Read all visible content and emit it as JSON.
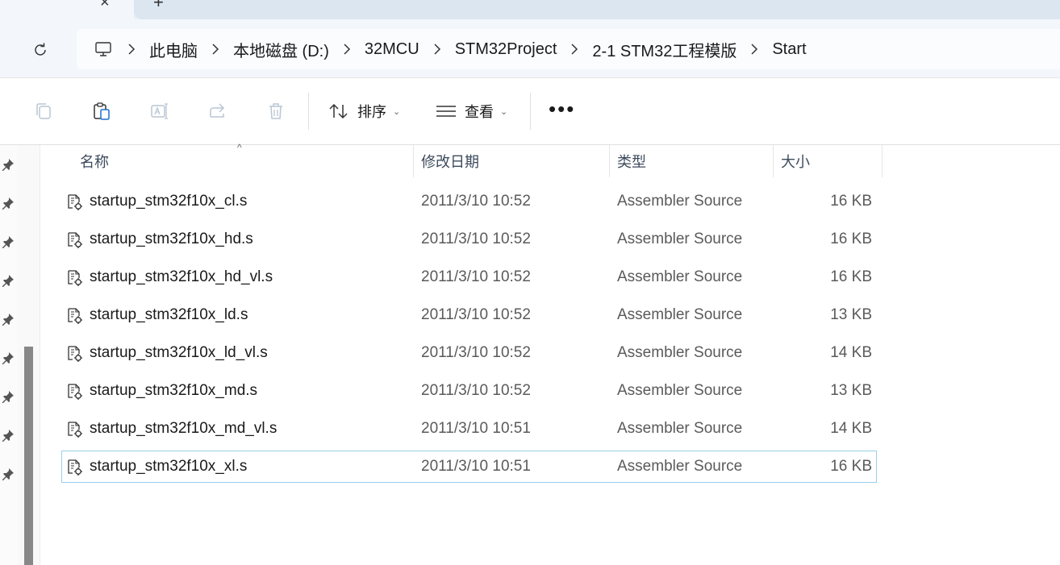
{
  "tabs": {
    "close_glyph": "×",
    "new_tab_glyph": "+"
  },
  "breadcrumb": [
    {
      "label": "此电脑"
    },
    {
      "label": "本地磁盘 (D:)"
    },
    {
      "label": "32MCU"
    },
    {
      "label": "STM32Project"
    },
    {
      "label": "2-1 STM32工程模版"
    },
    {
      "label": "Start"
    }
  ],
  "toolbar": {
    "sort_label": "排序",
    "view_label": "查看",
    "more_label": "•••"
  },
  "columns": {
    "name": "名称",
    "date": "修改日期",
    "type": "类型",
    "size": "大小"
  },
  "files": [
    {
      "name": "startup_stm32f10x_cl.s",
      "date": "2011/3/10 10:52",
      "type": "Assembler Source",
      "size": "16 KB"
    },
    {
      "name": "startup_stm32f10x_hd.s",
      "date": "2011/3/10 10:52",
      "type": "Assembler Source",
      "size": "16 KB"
    },
    {
      "name": "startup_stm32f10x_hd_vl.s",
      "date": "2011/3/10 10:52",
      "type": "Assembler Source",
      "size": "16 KB"
    },
    {
      "name": "startup_stm32f10x_ld.s",
      "date": "2011/3/10 10:52",
      "type": "Assembler Source",
      "size": "13 KB"
    },
    {
      "name": "startup_stm32f10x_ld_vl.s",
      "date": "2011/3/10 10:52",
      "type": "Assembler Source",
      "size": "14 KB"
    },
    {
      "name": "startup_stm32f10x_md.s",
      "date": "2011/3/10 10:52",
      "type": "Assembler Source",
      "size": "13 KB"
    },
    {
      "name": "startup_stm32f10x_md_vl.s",
      "date": "2011/3/10 10:51",
      "type": "Assembler Source",
      "size": "14 KB"
    },
    {
      "name": "startup_stm32f10x_xl.s",
      "date": "2011/3/10 10:51",
      "type": "Assembler Source",
      "size": "16 KB",
      "selected": true
    }
  ],
  "colors": {
    "selection_border": "#99cfea",
    "address_bg": "#f3f7fb",
    "scroll_thumb": "#888888"
  },
  "icons": {
    "tab_close": "close-icon",
    "refresh": "refresh-icon",
    "pc": "computer-icon",
    "copy": "copy-icon",
    "paste": "paste-icon",
    "rename": "rename-icon",
    "share": "share-icon",
    "delete": "trash-icon",
    "sort": "sort-icon",
    "view": "view-icon",
    "file": "assembler-file-icon",
    "pin": "pin-icon"
  }
}
